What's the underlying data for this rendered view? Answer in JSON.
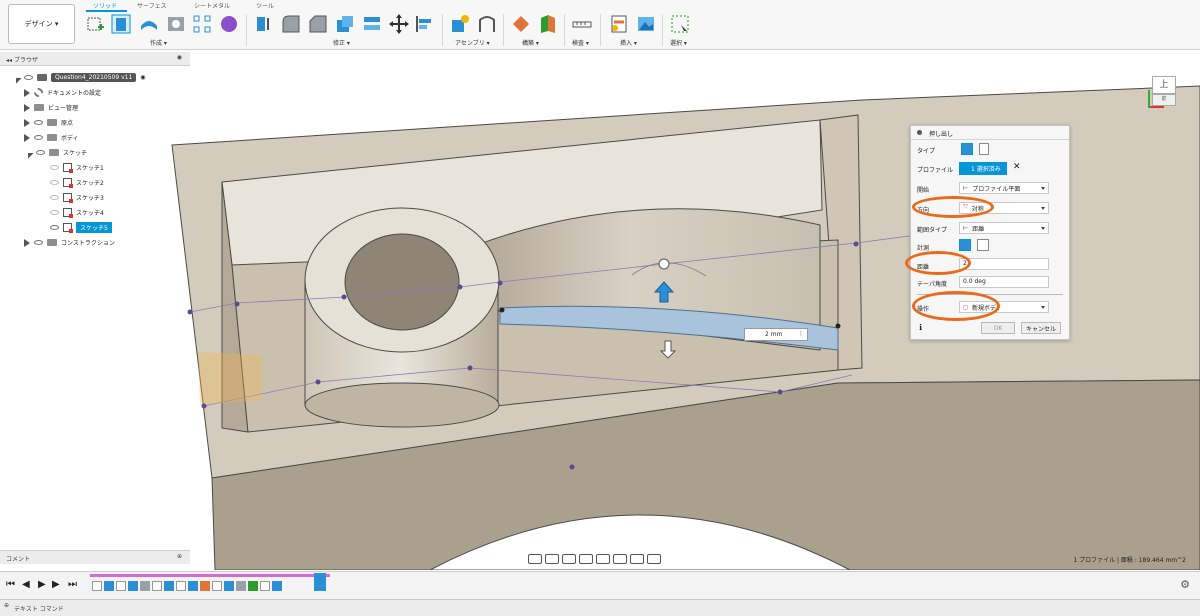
{
  "toolbar": {
    "design_label": "デザイン ▾",
    "tabs": [
      "ソリッド",
      "サーフェス",
      "シートメタル",
      "ツール"
    ],
    "groups": [
      "作成 ▾",
      "修正 ▾",
      "アセンブリ ▾",
      "構築 ▾",
      "検査 ▾",
      "挿入 ▾",
      "選択 ▾"
    ]
  },
  "browser": {
    "title": "ブラウザ",
    "root": "Question4_20210509 v11",
    "items": [
      "ドキュメントの設定",
      "ビュー管理",
      "原点",
      "ボディ",
      "スケッチ"
    ],
    "sketches": [
      "スケッチ1",
      "スケッチ2",
      "スケッチ3",
      "スケッチ4",
      "スケッチ5"
    ],
    "construction": "コンストラクション"
  },
  "comment": {
    "label": "コメント"
  },
  "viewcube": {
    "label": "上",
    "sub": "前"
  },
  "extrude_panel": {
    "title": "押し出し",
    "type_label": "タイプ",
    "profile_label": "プロファイル",
    "profile_value": "1 選択済み",
    "start_label": "開始",
    "start_value": "プロファイル平面",
    "direction_label": "方向",
    "direction_value": "対称",
    "extent_label": "範囲タイプ",
    "extent_value": "距離",
    "measure_label": "計測",
    "distance_label": "距離",
    "distance_value": "2",
    "taper_label": "テーパ角度",
    "taper_value": "0.0 deg",
    "operation_label": "操作",
    "operation_value": "新規ボディ",
    "ok_label": "OK",
    "cancel_label": "キャンセル"
  },
  "canvas": {
    "dim_value": "2 mm",
    "dim_small": "2 mm"
  },
  "status": {
    "readout": "1 プロファイル | 面積 : 189.464 mm^2"
  },
  "commandbar": {
    "label": "テキスト コマンド"
  },
  "colors": {
    "accent": "#0696d7",
    "highlight": "#ea6a1c",
    "model": "#d7d0c2"
  }
}
